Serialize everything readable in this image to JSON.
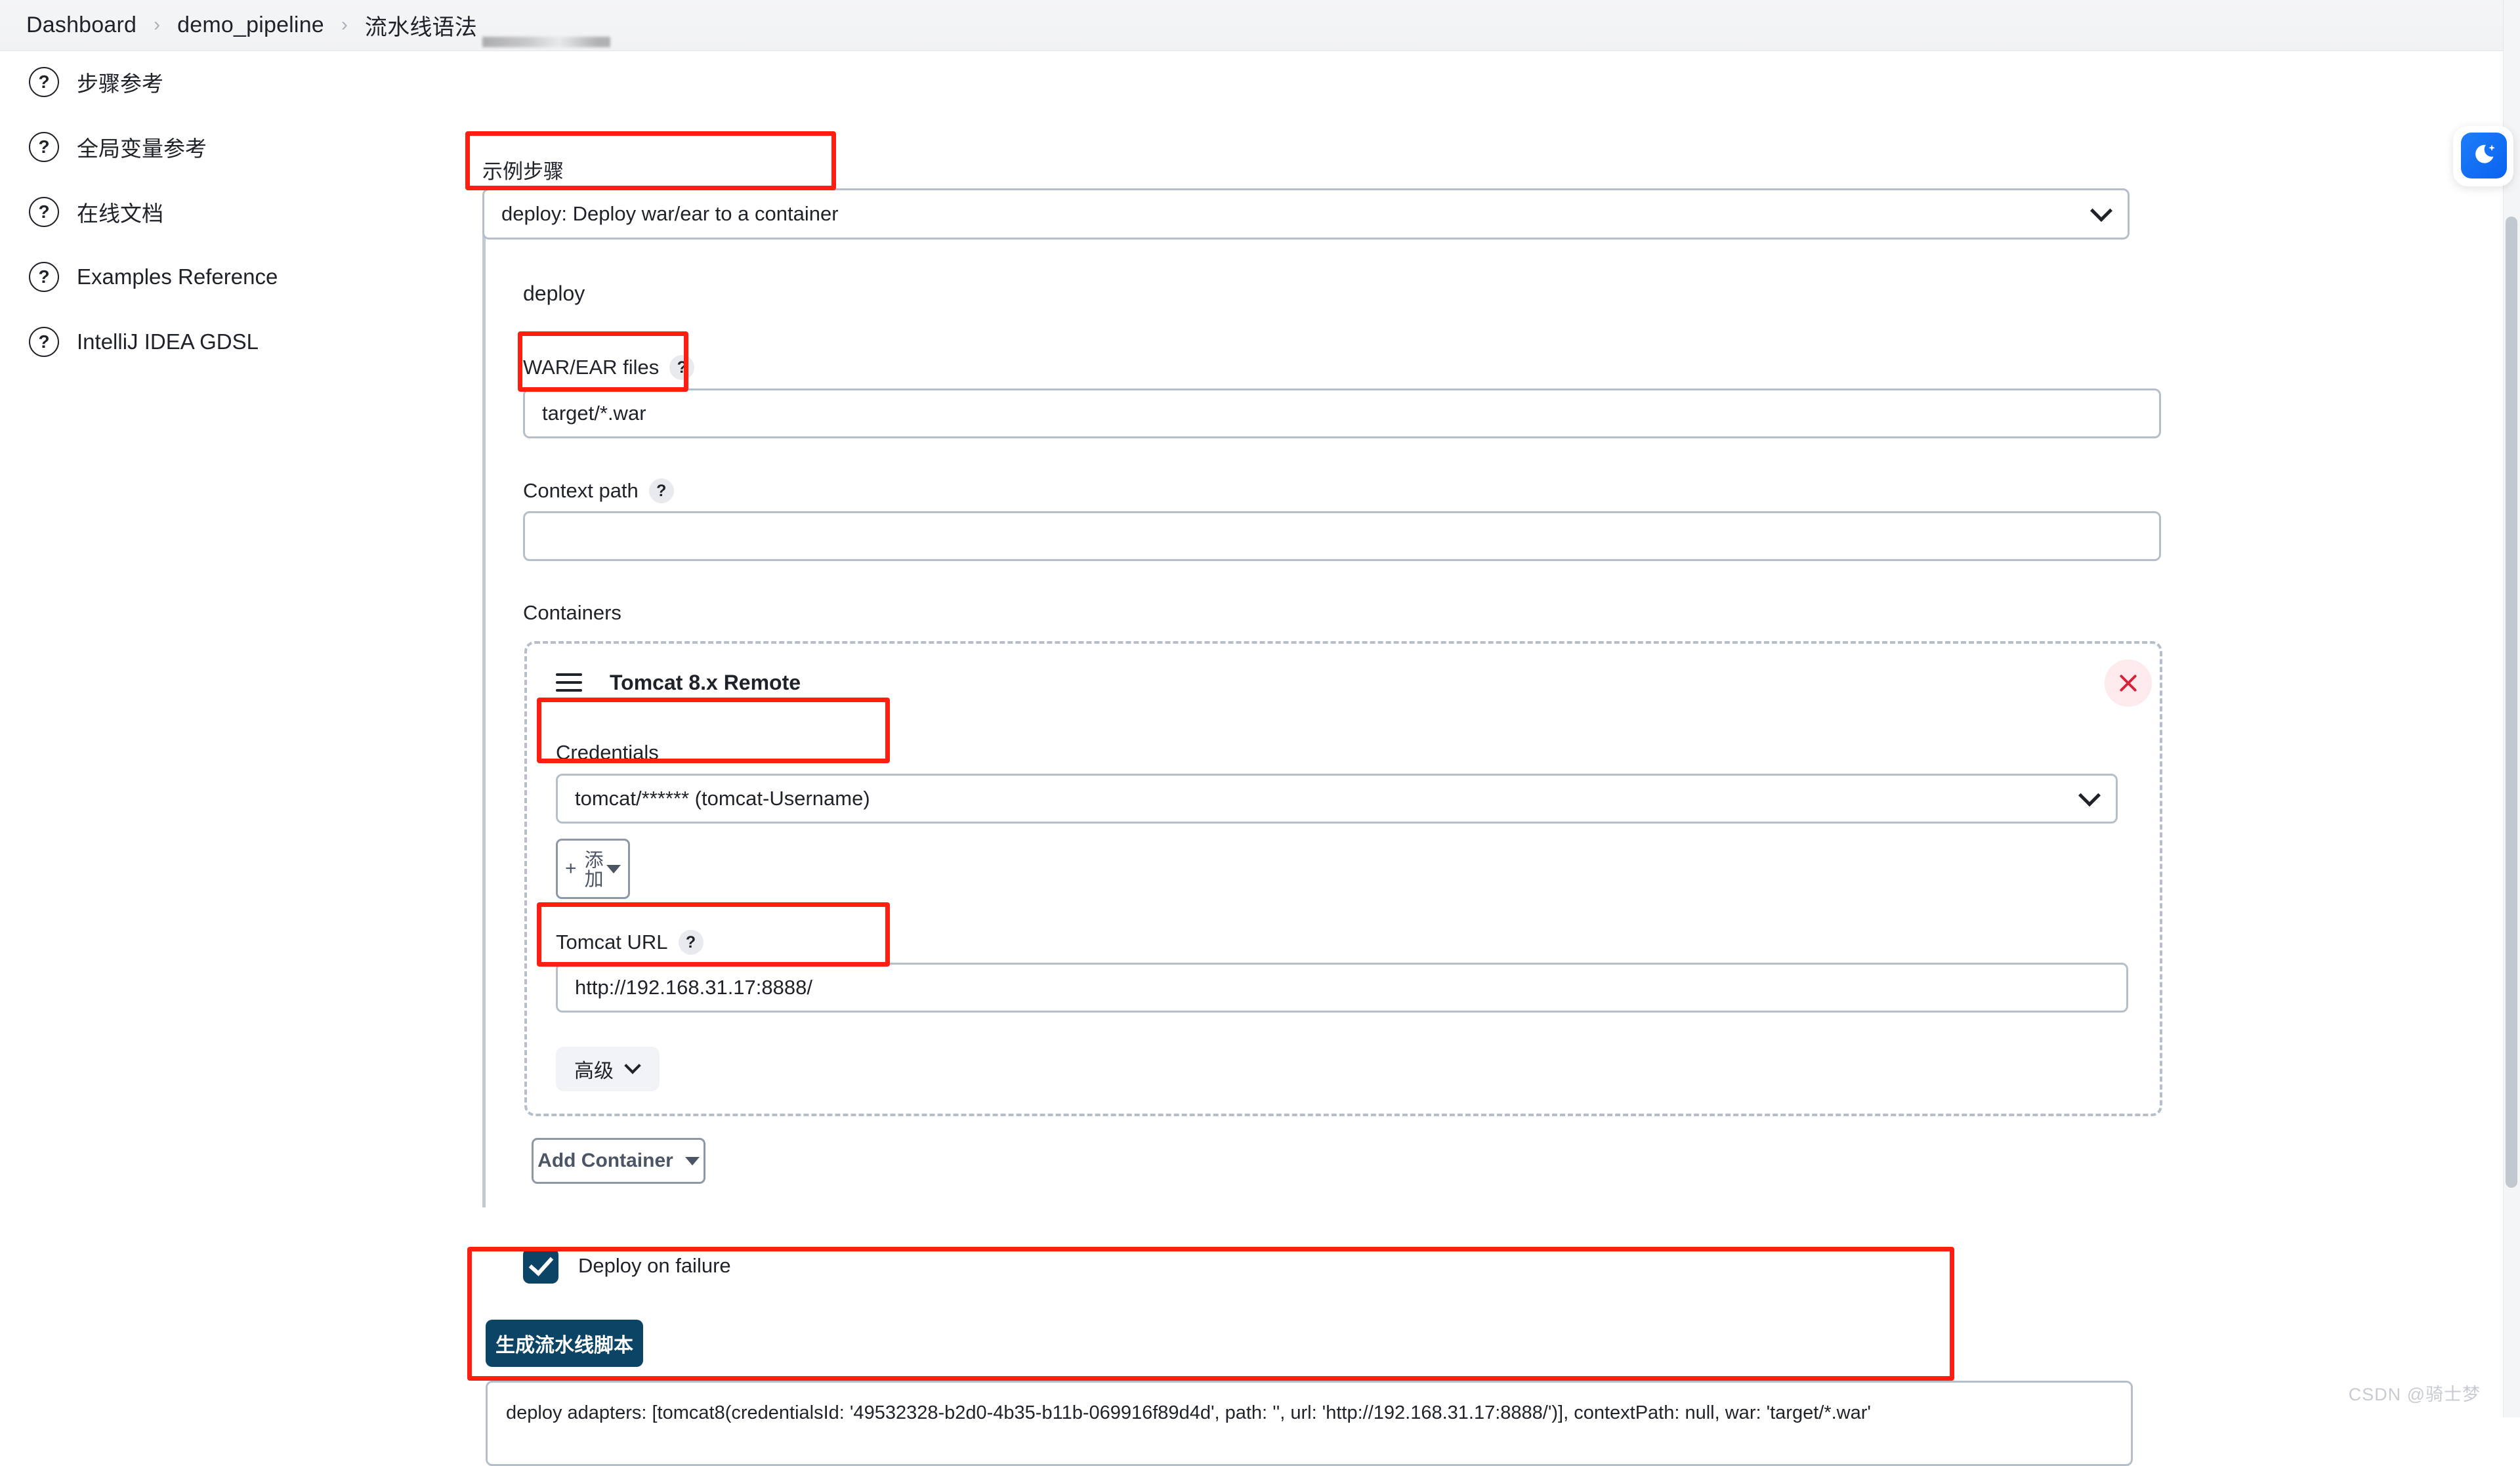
{
  "breadcrumb": {
    "items": [
      {
        "label": "Dashboard"
      },
      {
        "label": "demo_pipeline"
      },
      {
        "label": "流水线语法"
      }
    ],
    "separator": "›"
  },
  "sidebar": {
    "items": [
      {
        "icon": "help-circle-icon",
        "label": "步骤参考"
      },
      {
        "icon": "help-circle-icon",
        "label": "全局变量参考"
      },
      {
        "icon": "help-circle-icon",
        "label": "在线文档"
      },
      {
        "icon": "help-circle-icon",
        "label": "Examples Reference"
      },
      {
        "icon": "help-circle-icon",
        "label": "IntelliJ IDEA GDSL"
      }
    ]
  },
  "form": {
    "sample_step_label": "示例步骤",
    "sample_step_value": "deploy: Deploy war/ear to a container",
    "step_name": "deploy",
    "war_label": "WAR/EAR files",
    "war_value": "target/*.war",
    "context_label": "Context path",
    "context_value": "",
    "containers_label": "Containers",
    "help_glyph": "?"
  },
  "container_card": {
    "title": "Tomcat 8.x Remote",
    "drag_icon": "hamburger-icon",
    "close_icon": "close-icon",
    "credentials_label": "Credentials",
    "credentials_value": "tomcat/****** (tomcat-Username)",
    "add_button": {
      "plus": "+",
      "label": "添加"
    },
    "tomcat_url_label": "Tomcat URL",
    "tomcat_url_value": "http://192.168.31.17:8888/",
    "advanced_label": "高级"
  },
  "actions": {
    "add_container_label": "Add Container",
    "deploy_on_failure_label": "Deploy on failure",
    "deploy_on_failure_checked": true,
    "generate_label": "生成流水线脚本",
    "script_output": "deploy adapters: [tomcat8(credentialsId: '49532328-b2d0-4b35-b11b-069916f89d4d', path: '', url: 'http://192.168.31.17:8888/')], contextPath: null, war: 'target/*.war'"
  },
  "floating": {
    "icon": "moon-sparkle-icon"
  },
  "watermark": {
    "text": "CSDN @骑士梦"
  },
  "colors": {
    "accent": "#0b4464",
    "highlight": "#ff1e10",
    "border": "#b6bfc9",
    "fab": "#0a63f0"
  }
}
